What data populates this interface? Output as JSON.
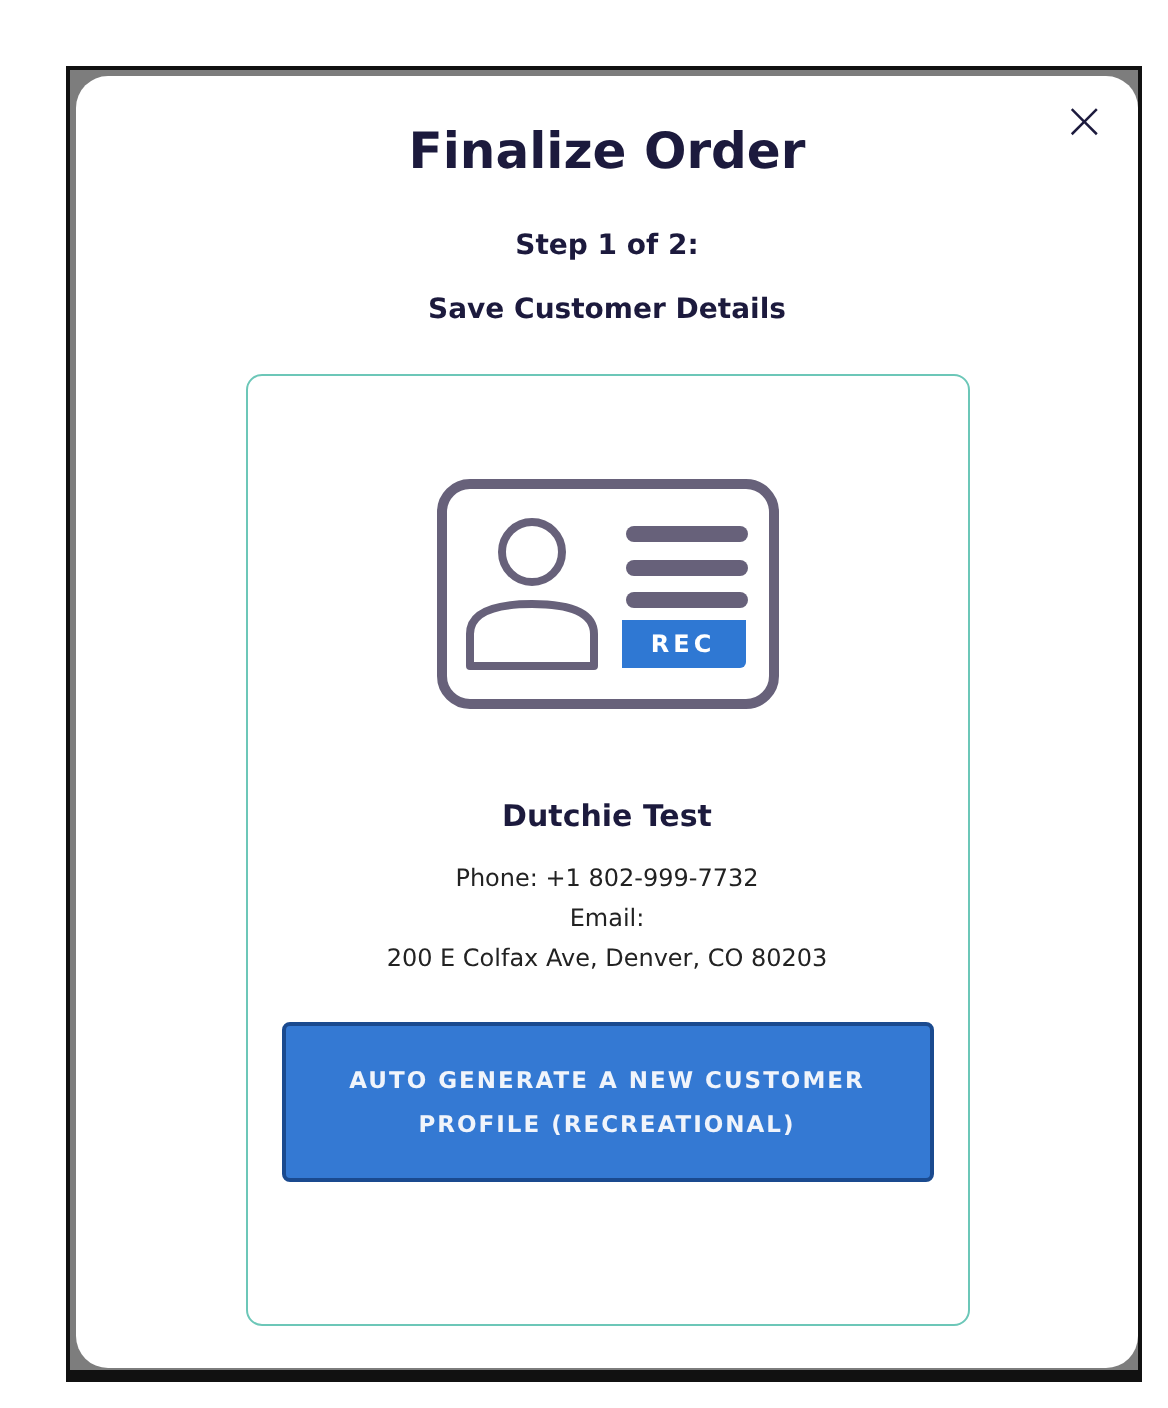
{
  "dialog": {
    "title": "Finalize Order",
    "close": "×",
    "step": "Step 1 of 2:",
    "subtitle": "Save Customer Details"
  },
  "customer": {
    "badge": "REC",
    "name": "Dutchie Test",
    "phone": "Phone: +1 802-999-7732",
    "email": "Email:",
    "address": "200 E Colfax Ave, Denver, CO 80203"
  },
  "button": "AUTO GENERATE A NEW CUSTOMER PROFILE (RECREATIONAL)"
}
